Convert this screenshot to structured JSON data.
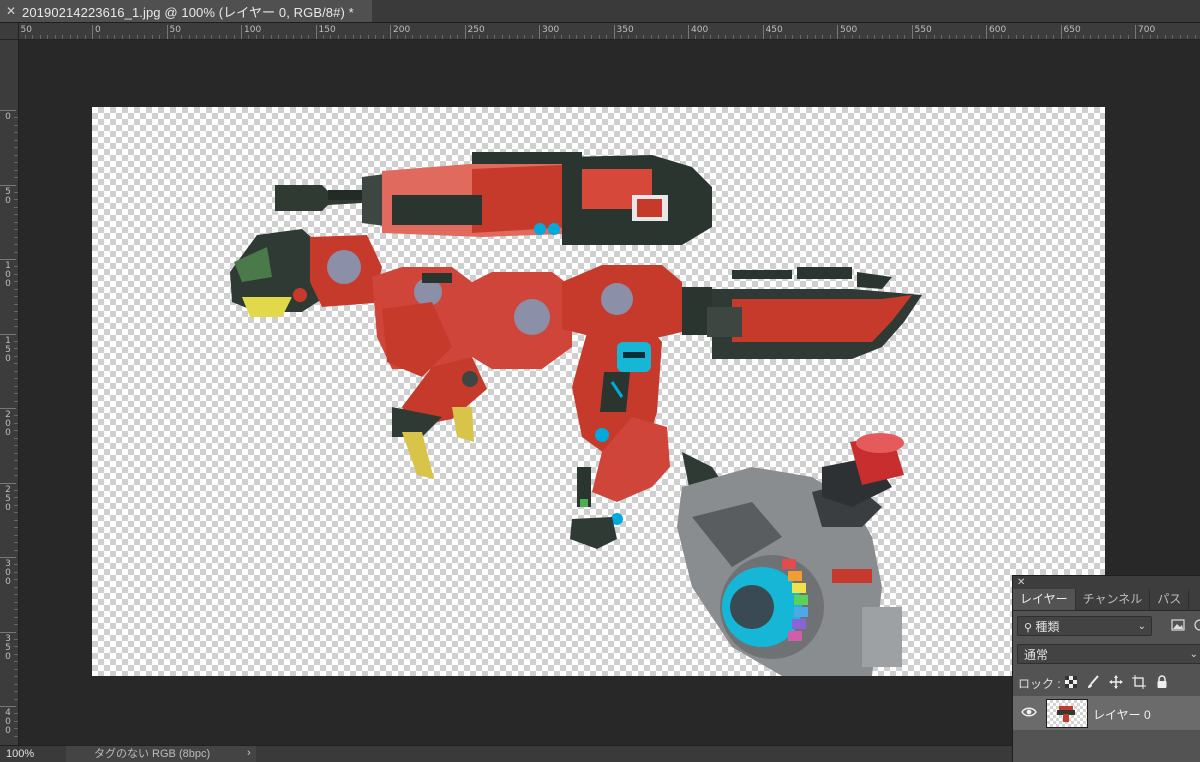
{
  "document": {
    "tab_title": "20190214223616_1.jpg @ 100% (レイヤー 0, RGB/8#) *",
    "close_glyph": "✕"
  },
  "ruler_top_labels": [
    "50",
    "0",
    "50",
    "100",
    "150",
    "200",
    "250",
    "300",
    "350",
    "400",
    "450",
    "500",
    "550",
    "600",
    "650",
    "700"
  ],
  "ruler_left_labels": [
    "0",
    "50",
    "100",
    "150",
    "200",
    "250",
    "300",
    "350",
    "400"
  ],
  "status": {
    "zoom": "100%",
    "doc_info": "タグのない RGB (8bpc)",
    "arrow": "›"
  },
  "layers_panel": {
    "close_glyph": "✕",
    "tabs": [
      {
        "label": "レイヤー",
        "active": true
      },
      {
        "label": "チャンネル",
        "active": false
      },
      {
        "label": "パス",
        "active": false
      }
    ],
    "filter": {
      "label": "種類",
      "icon": "search-icon"
    },
    "blend_mode": "通常",
    "lock_label": "ロック :",
    "layers": [
      {
        "name": "レイヤー 0",
        "visible": true
      }
    ]
  },
  "colors": {
    "accent_red": "#c8372a",
    "dark_plate": "#2e3a33",
    "panel_bg": "#535353",
    "pasteboard": "#282828"
  }
}
